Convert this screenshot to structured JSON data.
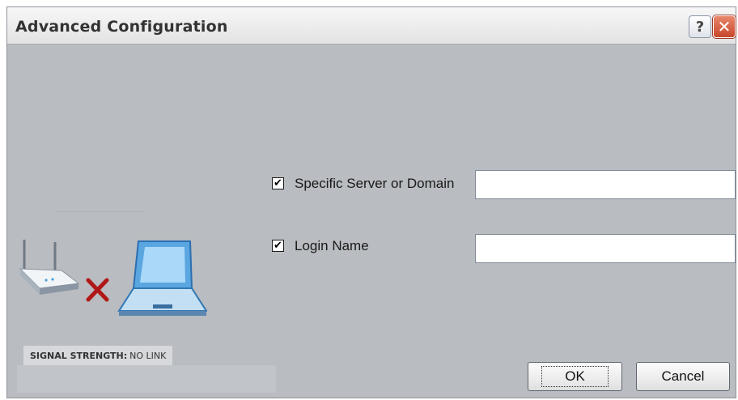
{
  "dialog": {
    "title": "Advanced Configuration",
    "help_symbol": "?",
    "close_symbol": "✕"
  },
  "form": {
    "server": {
      "label": "Specific Server or Domain",
      "checked": true,
      "value": ""
    },
    "login": {
      "label": "Login Name",
      "checked": true,
      "value": ""
    }
  },
  "status": {
    "signal_label": "SIGNAL STRENGTH:",
    "signal_value": "NO LINK"
  },
  "buttons": {
    "ok": "OK",
    "cancel": "Cancel"
  },
  "icons": [
    "router-icon",
    "no-link-x-icon",
    "laptop-icon"
  ],
  "colors": {
    "dialog_bg": "#b9bcc0",
    "close_button": "#c8462a",
    "no_link_x": "#b01818"
  }
}
